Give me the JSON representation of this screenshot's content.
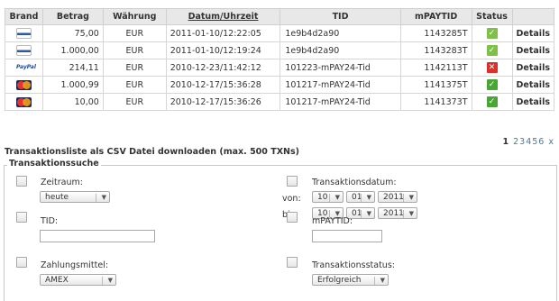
{
  "table": {
    "headers": [
      "Brand",
      "Betrag",
      "Währung",
      "Datum/Uhrzeit",
      "TID",
      "mPAYTID",
      "Status",
      ""
    ],
    "rows": [
      {
        "brand": "bank-icon",
        "amount": "75,00",
        "currency": "EUR",
        "datetime": "2011-01-10/12:22:05",
        "tid": "1e9b4d2a90",
        "mpaytid": "1143285T",
        "status": "pending-icon",
        "details": "Details"
      },
      {
        "brand": "bank-icon",
        "amount": "1.000,00",
        "currency": "EUR",
        "datetime": "2011-01-10/12:19:24",
        "tid": "1e9b4d2a90",
        "mpaytid": "1143283T",
        "status": "pending-icon",
        "details": "Details"
      },
      {
        "brand": "paypal-logo",
        "brand_text": "PayPal",
        "amount": "214,11",
        "currency": "EUR",
        "datetime": "2010-12-23/11:42:12",
        "tid": "101223-mPAY24-Tid",
        "mpaytid": "1142113T",
        "status": "error-icon",
        "details": "Details"
      },
      {
        "brand": "mastercard-logo",
        "amount": "1.000,99",
        "currency": "EUR",
        "datetime": "2010-12-17/15:36:28",
        "tid": "101217-mPAY24-Tid",
        "mpaytid": "1141375T",
        "status": "success-icon",
        "details": "Details"
      },
      {
        "brand": "mastercard-logo",
        "amount": "10,00",
        "currency": "EUR",
        "datetime": "2010-12-17/15:36:26",
        "tid": "101217-mPAY24-Tid",
        "mpaytid": "1141373T",
        "status": "success-icon",
        "details": "Details"
      }
    ]
  },
  "pagination": {
    "current": "1",
    "pages": [
      "2",
      "3",
      "4",
      "5",
      "6"
    ],
    "more": "x"
  },
  "csv_link": "Transaktionsliste als CSV Datei downloaden (max. 500 TXNs)",
  "search": {
    "legend": "Transaktionssuche",
    "zeitraum": {
      "label": "Zeitraum:",
      "value": "heute"
    },
    "transaktionsdatum": {
      "label": "Transaktionsdatum:",
      "von_label": "von:",
      "bis_label": "bis:",
      "von": {
        "day": "10",
        "month": "01",
        "year": "2011"
      },
      "bis": {
        "day": "10",
        "month": "01",
        "year": "2011"
      }
    },
    "tid": {
      "label": "TID:",
      "value": ""
    },
    "mpaytid": {
      "label": "mPAYTID:",
      "value": ""
    },
    "zahlungsmittel": {
      "label": "Zahlungsmittel:",
      "value": "AMEX"
    },
    "transaktionsstatus": {
      "label": "Transaktionsstatus:",
      "value": "Erfolgreich"
    }
  },
  "colors": {
    "header_bg": "#e8e8e8",
    "ok": "#4aa537",
    "error": "#d9302a",
    "pending": "#7ec04a"
  }
}
